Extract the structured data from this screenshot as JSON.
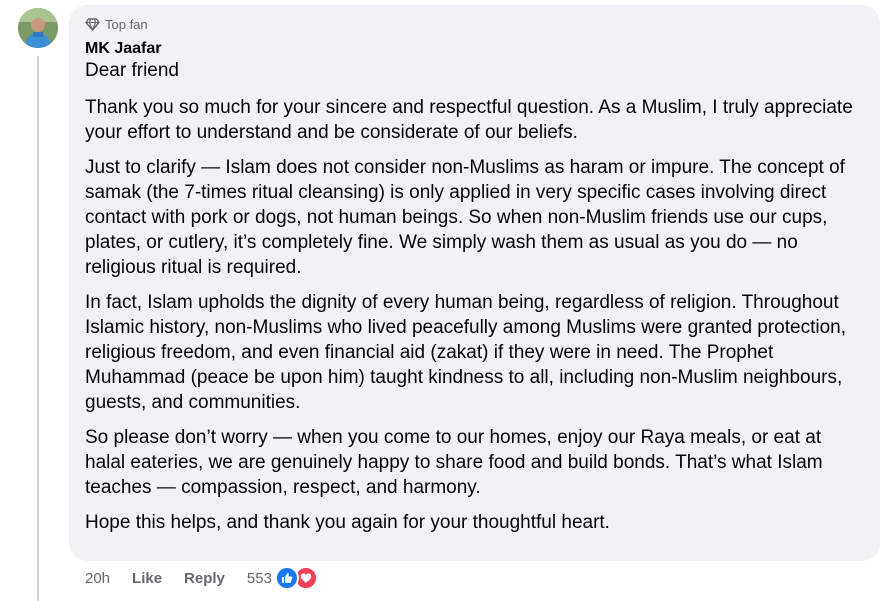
{
  "comment": {
    "badge": "Top fan",
    "author": "MK Jaafar",
    "greeting": "Dear friend",
    "paragraphs": [
      "Thank you so much for your sincere and respectful question. As a Muslim, I truly appreciate your effort to understand and be considerate of our beliefs.",
      "Just to clarify — Islam does not consider non-Muslims as haram or impure. The concept of samak (the 7-times ritual cleansing) is only applied in very specific cases involving direct contact with pork or dogs, not human beings. So when non-Muslim friends use our cups, plates, or cutlery, it’s completely fine. We simply wash them as usual as you do — no religious ritual is required.",
      "In fact, Islam upholds the dignity of every human being, regardless of religion. Throughout Islamic history, non-Muslims who lived peacefully among Muslims were granted protection, religious freedom, and even financial aid (zakat) if they were in need. The Prophet Muhammad (peace be upon him) taught kindness to all, including non-Muslim neighbours, guests, and communities.",
      "So please don’t worry — when you come to our homes, enjoy our Raya meals, or eat at halal eateries, we are genuinely happy to share food and build bonds. That’s what Islam teaches — compassion, respect, and harmony.",
      "Hope this helps, and thank you again for your thoughtful heart."
    ],
    "time": "20h",
    "like_label": "Like",
    "reply_label": "Reply",
    "reaction_count": "553",
    "reaction_icons": [
      "like-icon",
      "love-icon"
    ]
  },
  "colors": {
    "bubble": "#f0f2f5",
    "meta_text": "#65676b",
    "like_blue": "#1877f2",
    "love_red": "#f33e58",
    "thread_line": "#ced0d4"
  }
}
